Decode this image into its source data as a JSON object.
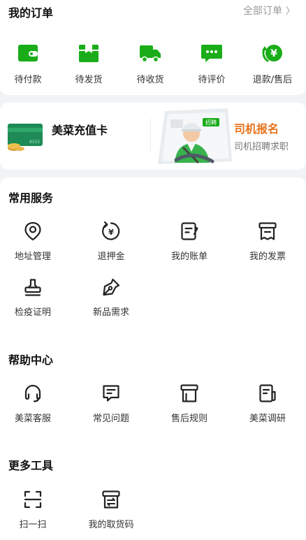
{
  "orders": {
    "title": "我的订单",
    "all_label": "全部订单",
    "items": [
      {
        "label": "待付款",
        "icon": "wallet-icon"
      },
      {
        "label": "待发货",
        "icon": "package-icon"
      },
      {
        "label": "待收货",
        "icon": "truck-icon"
      },
      {
        "label": "待评价",
        "icon": "comment-icon"
      },
      {
        "label": "退款/售后",
        "icon": "refund-icon"
      }
    ]
  },
  "promo": {
    "card_title": "美菜充值卡",
    "card_number": "8555",
    "driver_title": "司机报名",
    "driver_subtitle": "司机招聘求职",
    "driver_badge": "招聘"
  },
  "common_services": {
    "title": "常用服务",
    "items": [
      {
        "label": "地址管理",
        "icon": "location-icon"
      },
      {
        "label": "退押金",
        "icon": "deposit-refund-icon"
      },
      {
        "label": "我的账单",
        "icon": "bill-icon"
      },
      {
        "label": "我的发票",
        "icon": "invoice-icon"
      },
      {
        "label": "检疫证明",
        "icon": "stamp-icon"
      },
      {
        "label": "新品需求",
        "icon": "pen-icon"
      }
    ]
  },
  "help_center": {
    "title": "帮助中心",
    "items": [
      {
        "label": "美菜客服",
        "icon": "headset-icon"
      },
      {
        "label": "常见问题",
        "icon": "faq-icon"
      },
      {
        "label": "售后规则",
        "icon": "rules-icon"
      },
      {
        "label": "美菜调研",
        "icon": "survey-icon"
      }
    ]
  },
  "more_tools": {
    "title": "更多工具",
    "items": [
      {
        "label": "扫一扫",
        "icon": "scan-icon"
      },
      {
        "label": "我的取货码",
        "icon": "pickup-code-icon"
      }
    ]
  },
  "colors": {
    "accent": "#1aad19",
    "driver_orange": "#e8731c",
    "background": "#f2f3f5"
  }
}
